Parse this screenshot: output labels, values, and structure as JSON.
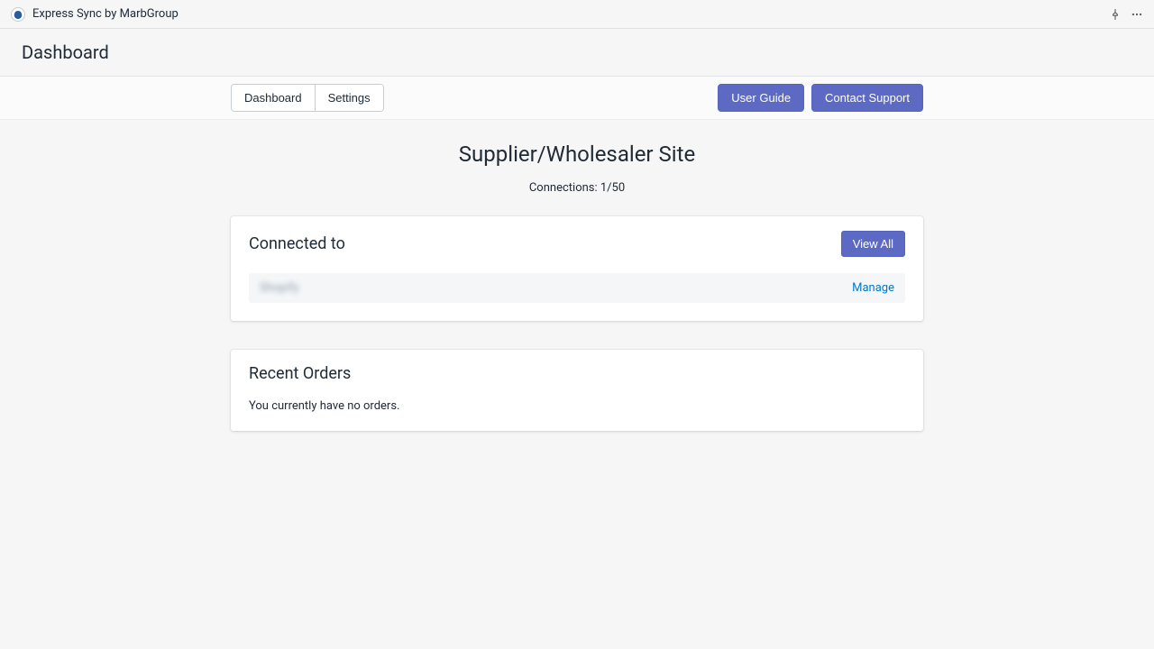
{
  "titlebar": {
    "app_name": "Express Sync by MarbGroup"
  },
  "header": {
    "title": "Dashboard"
  },
  "toolbar": {
    "tabs": {
      "dashboard": "Dashboard",
      "settings": "Settings"
    },
    "buttons": {
      "user_guide": "User Guide",
      "contact_support": "Contact Support"
    }
  },
  "page": {
    "title": "Supplier/Wholesaler Site",
    "connections_label": "Connections: 1/50"
  },
  "connected_card": {
    "title": "Connected to",
    "view_all": "View All",
    "row_name": "Shopify",
    "manage": "Manage"
  },
  "orders_card": {
    "title": "Recent Orders",
    "empty_text": "You currently have no orders."
  }
}
